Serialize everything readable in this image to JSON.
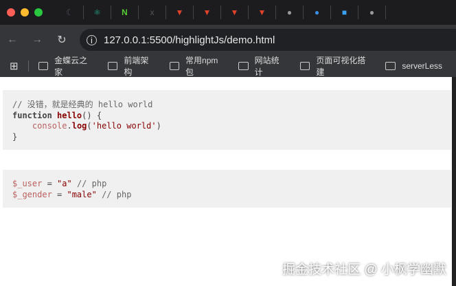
{
  "browser": {
    "url": "127.0.0.1:5500/highlightJs/demo.html",
    "bookmarks": [
      "金蝶云之家",
      "前端架构",
      "常用npm包",
      "网站统计",
      "页面可视化搭建",
      "serverLess"
    ]
  },
  "code1": {
    "comment": "// 没错，就是经典的 hello world",
    "kw": "function",
    "fn": "hello",
    "rest1": "() {",
    "indent": "    ",
    "obj": "console",
    "dot": ".",
    "method": "log",
    "p1": "(",
    "str": "'hello world'",
    "p2": ")",
    "close": "}"
  },
  "code2": {
    "v1": "$_user",
    "eq1": " = ",
    "s1": "\"a\"",
    "c1": " // php",
    "v2": "$_gender",
    "eq2": " = ",
    "s2": "\"male\"",
    "c2": " // php"
  },
  "watermark": "掘金技术社区 @ 小枫学幽默"
}
